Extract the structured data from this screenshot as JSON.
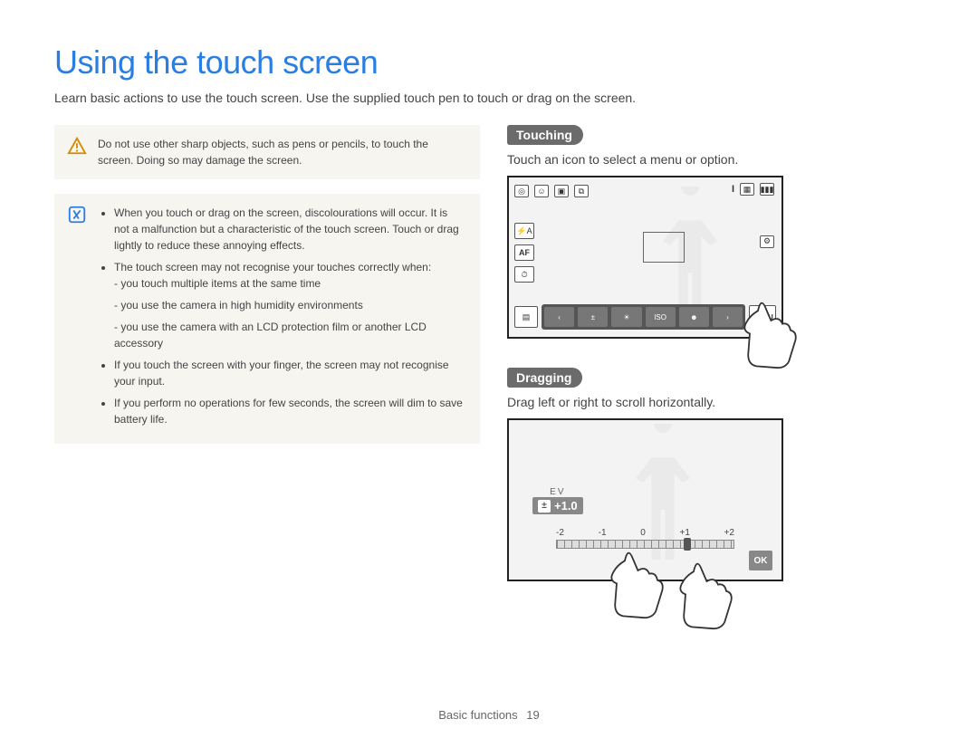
{
  "title": "Using the touch screen",
  "intro": "Learn basic actions to use the touch screen. Use the supplied touch pen to touch or drag on the screen.",
  "warning": {
    "text": "Do not use other sharp objects, such as pens or pencils, to touch the screen. Doing so may damage the screen."
  },
  "note": {
    "bullets": [
      "When you touch or drag on the screen, discolourations will occur. It is not a malfunction but a characteristic of the touch screen. Touch or drag lightly to reduce these annoying effects.",
      "The touch screen may not recognise your touches correctly when:",
      "If you touch the screen with your finger, the screen may not recognise your input.",
      "If you perform no operations for few seconds, the screen will dim to save battery life."
    ],
    "subbullets": [
      "you touch multiple items at the same time",
      "you use the camera in high humidity environments",
      "you use the camera with an LCD protection film or another LCD accessory"
    ]
  },
  "sections": {
    "touching": {
      "label": "Touching",
      "desc": "Touch an icon to select a menu or option."
    },
    "dragging": {
      "label": "Dragging",
      "desc": "Drag left or right to scroll horizontally."
    }
  },
  "shot1": {
    "topbar_icons": [
      "camera-mode-icon",
      "face-mode-icon",
      "bracket-mode-icon",
      "video-mode-icon"
    ],
    "topright_icons": [
      "info-icon",
      "memory-icon",
      "battery-icon"
    ],
    "left_icons": [
      "flash-auto-icon",
      "af-mode-icon",
      "timer-off-icon"
    ],
    "menu_label": "MENU"
  },
  "shot2": {
    "ev_label": "EV",
    "ev_value": "+1.0",
    "scale": [
      "-2",
      "-1",
      "0",
      "+1",
      "+2"
    ],
    "ok_label": "OK"
  },
  "footer": {
    "section": "Basic functions",
    "page": "19"
  }
}
